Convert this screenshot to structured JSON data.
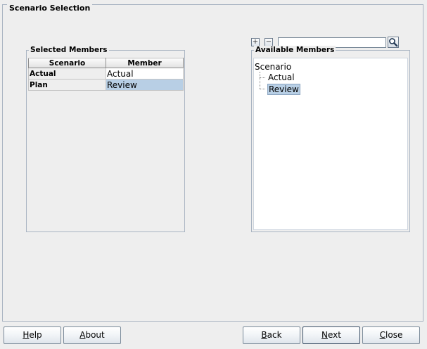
{
  "window": {
    "title": "Scenario Selection"
  },
  "selected_members": {
    "title": "Selected Members",
    "columns": [
      "Scenario",
      "Member"
    ],
    "rows": [
      {
        "scenario": "Actual",
        "member": "Actual",
        "selected": false
      },
      {
        "scenario": "Plan",
        "member": "Review",
        "selected": true
      }
    ]
  },
  "toolbar": {
    "expand_symbol": "+",
    "collapse_symbol": "−",
    "search_value": "",
    "search_icon": "magnifier-icon"
  },
  "available_members": {
    "title": "Available Members",
    "root": "Scenario",
    "children": [
      "Actual",
      "Review"
    ],
    "selected_child": "Review"
  },
  "buttons": {
    "help": {
      "mnemonic": "H",
      "rest": "elp"
    },
    "about": {
      "mnemonic": "A",
      "rest": "bout"
    },
    "back": {
      "mnemonic": "B",
      "rest": "ack"
    },
    "next": {
      "mnemonic": "N",
      "rest": "ext"
    },
    "close": {
      "mnemonic": "C",
      "rest": "lose"
    }
  },
  "colors": {
    "selection": "#b8cfe5",
    "border": "#a9b4c2",
    "background": "#eeeeee"
  }
}
